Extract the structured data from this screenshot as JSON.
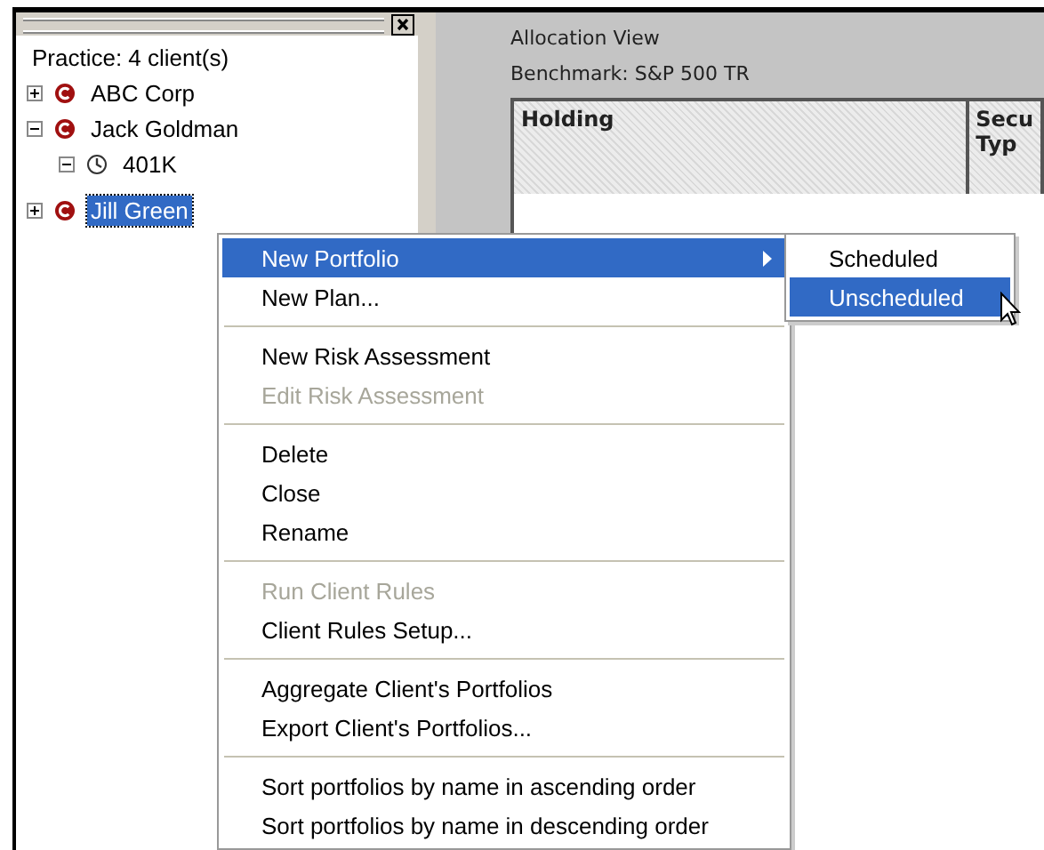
{
  "tree": {
    "title": "Practice: 4 client(s)",
    "items": [
      {
        "label": "ABC Corp",
        "kind": "client",
        "expanded": false,
        "selected": false
      },
      {
        "label": "Jack Goldman",
        "kind": "client",
        "expanded": true,
        "selected": false,
        "children": [
          {
            "label": "401K",
            "kind": "portfolio",
            "expanded": true,
            "selected": false
          }
        ]
      },
      {
        "label": "Jill Green",
        "kind": "client",
        "expanded": false,
        "selected": true
      }
    ]
  },
  "view": {
    "title": "Allocation View",
    "benchmark": "Benchmark: S&P 500 TR",
    "columns": [
      {
        "label": "Holding"
      },
      {
        "label": "Secu\nTyp"
      }
    ]
  },
  "context_menu": {
    "items": [
      {
        "kind": "item",
        "label": "New Portfolio",
        "disabled": false,
        "selected": true,
        "submenu": true
      },
      {
        "kind": "item",
        "label": "New Plan...",
        "disabled": false,
        "selected": false,
        "submenu": false
      },
      {
        "kind": "separator"
      },
      {
        "kind": "item",
        "label": "New Risk Assessment",
        "disabled": false,
        "selected": false,
        "submenu": false
      },
      {
        "kind": "item",
        "label": "Edit Risk Assessment",
        "disabled": true,
        "selected": false,
        "submenu": false
      },
      {
        "kind": "separator"
      },
      {
        "kind": "item",
        "label": "Delete",
        "disabled": false,
        "selected": false,
        "submenu": false
      },
      {
        "kind": "item",
        "label": "Close",
        "disabled": false,
        "selected": false,
        "submenu": false
      },
      {
        "kind": "item",
        "label": "Rename",
        "disabled": false,
        "selected": false,
        "submenu": false
      },
      {
        "kind": "separator"
      },
      {
        "kind": "item",
        "label": "Run Client Rules",
        "disabled": true,
        "selected": false,
        "submenu": false
      },
      {
        "kind": "item",
        "label": "Client Rules Setup...",
        "disabled": false,
        "selected": false,
        "submenu": false
      },
      {
        "kind": "separator"
      },
      {
        "kind": "item",
        "label": "Aggregate Client's Portfolios",
        "disabled": false,
        "selected": false,
        "submenu": false
      },
      {
        "kind": "item",
        "label": "Export Client's Portfolios...",
        "disabled": false,
        "selected": false,
        "submenu": false
      },
      {
        "kind": "separator"
      },
      {
        "kind": "item",
        "label": "Sort portfolios by name in ascending order",
        "disabled": false,
        "selected": false,
        "submenu": false
      },
      {
        "kind": "item",
        "label": "Sort portfolios by name in descending order",
        "disabled": false,
        "selected": false,
        "submenu": false
      }
    ]
  },
  "submenu": {
    "items": [
      {
        "kind": "item",
        "label": "Scheduled",
        "disabled": false,
        "selected": false,
        "submenu": false
      },
      {
        "kind": "item",
        "label": "Unscheduled",
        "disabled": false,
        "selected": true,
        "submenu": false
      }
    ]
  }
}
